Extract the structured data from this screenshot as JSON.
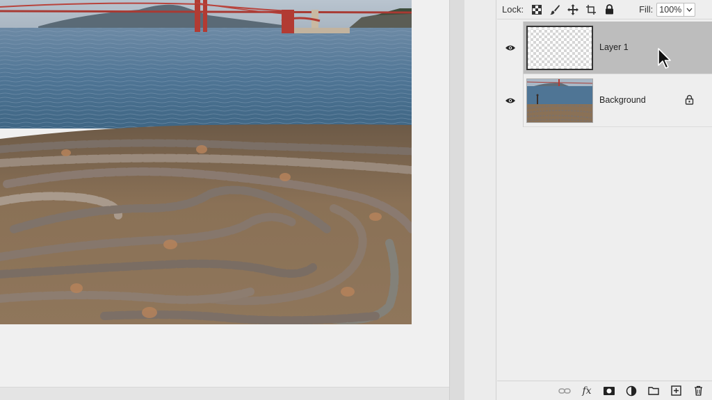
{
  "lock_bar": {
    "lock_label": "Lock:",
    "fill_label": "Fill:",
    "fill_value": "100%"
  },
  "layers": [
    {
      "name": "Layer 1",
      "selected": true,
      "visible": true,
      "locked": false
    },
    {
      "name": "Background",
      "selected": false,
      "visible": true,
      "locked": true
    }
  ],
  "footer_icons": [
    "link-layers-icon",
    "fx-icon",
    "mask-icon",
    "adjustment-icon",
    "folder-icon",
    "new-layer-icon",
    "trash-icon"
  ],
  "colors": {
    "selected_row": "#bdbdbd",
    "panel_bg": "#eeeeee",
    "water": "#4f7595",
    "ground": "#8a7156"
  }
}
